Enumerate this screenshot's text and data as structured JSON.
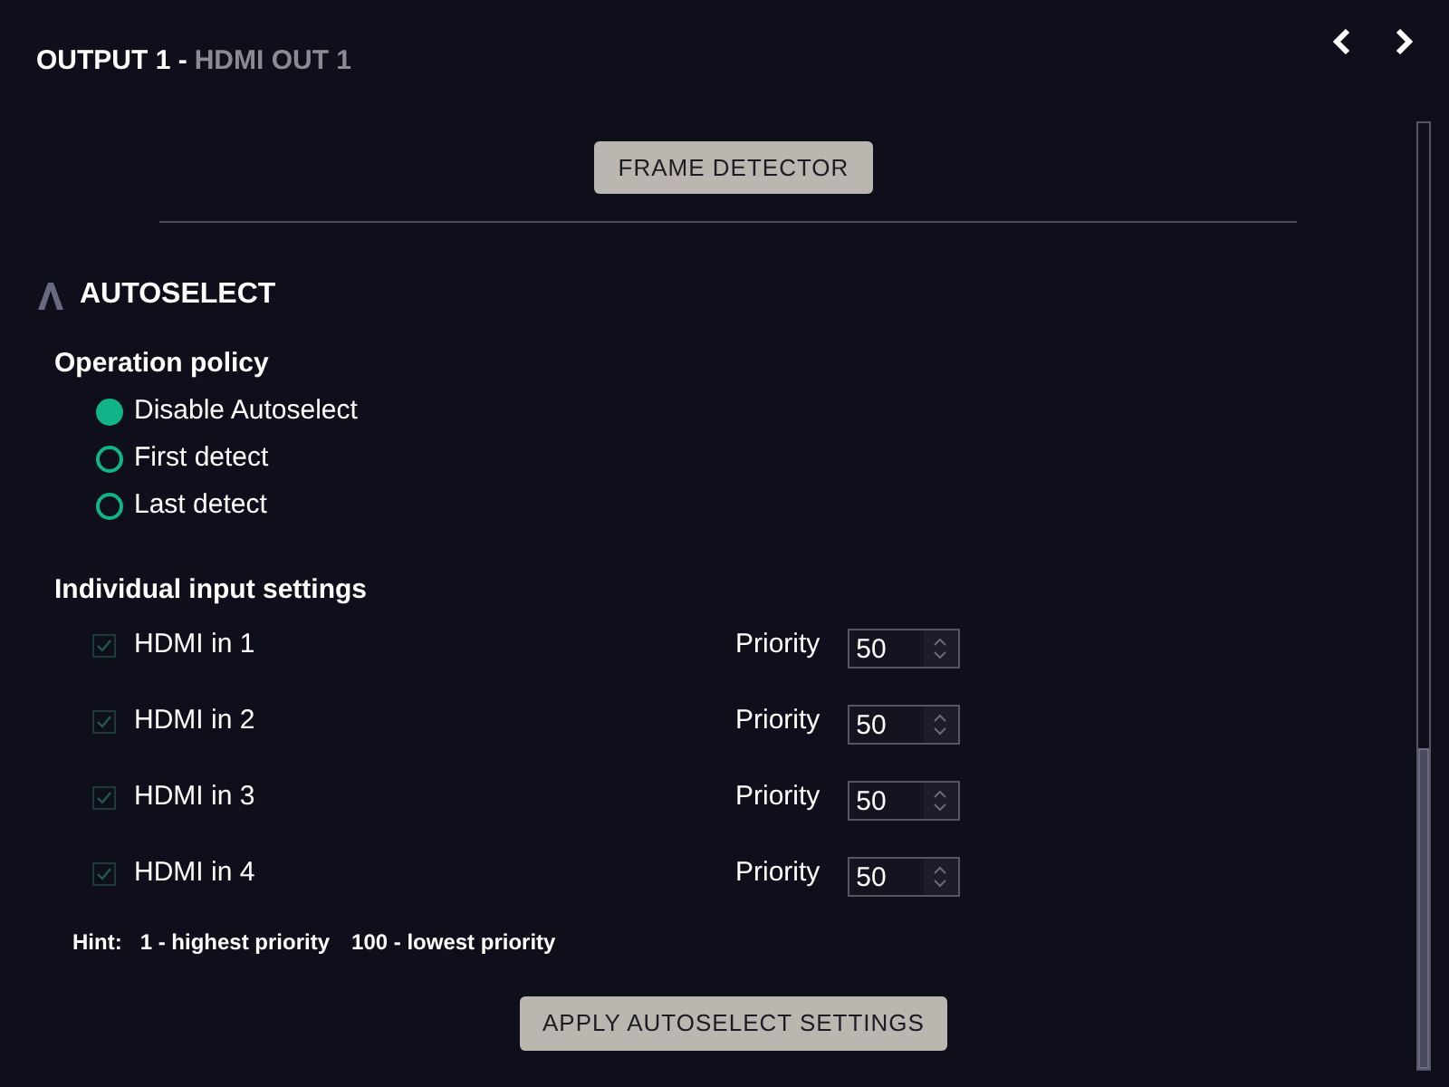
{
  "header": {
    "title": "OUTPUT 1 -",
    "subtitle": "HDMI OUT 1"
  },
  "frame_detector_button": "FRAME DETECTOR",
  "section": {
    "title": "AUTOSELECT"
  },
  "operation_policy": {
    "label": "Operation policy",
    "options": [
      {
        "label": "Disable Autoselect",
        "selected": true
      },
      {
        "label": "First detect",
        "selected": false
      },
      {
        "label": "Last detect",
        "selected": false
      }
    ]
  },
  "individual_inputs": {
    "label": "Individual input settings",
    "rows": [
      {
        "name": "HDMI in 1",
        "checked": true,
        "priority_label": "Priority",
        "value": "50"
      },
      {
        "name": "HDMI in 2",
        "checked": true,
        "priority_label": "Priority",
        "value": "50"
      },
      {
        "name": "HDMI in 3",
        "checked": true,
        "priority_label": "Priority",
        "value": "50"
      },
      {
        "name": "HDMI in 4",
        "checked": true,
        "priority_label": "Priority",
        "value": "50"
      }
    ]
  },
  "hint": {
    "label": "Hint:",
    "parts": [
      "1 - highest priority",
      "100 - lowest priority"
    ]
  },
  "apply_button": "APPLY AUTOSELECT SETTINGS"
}
